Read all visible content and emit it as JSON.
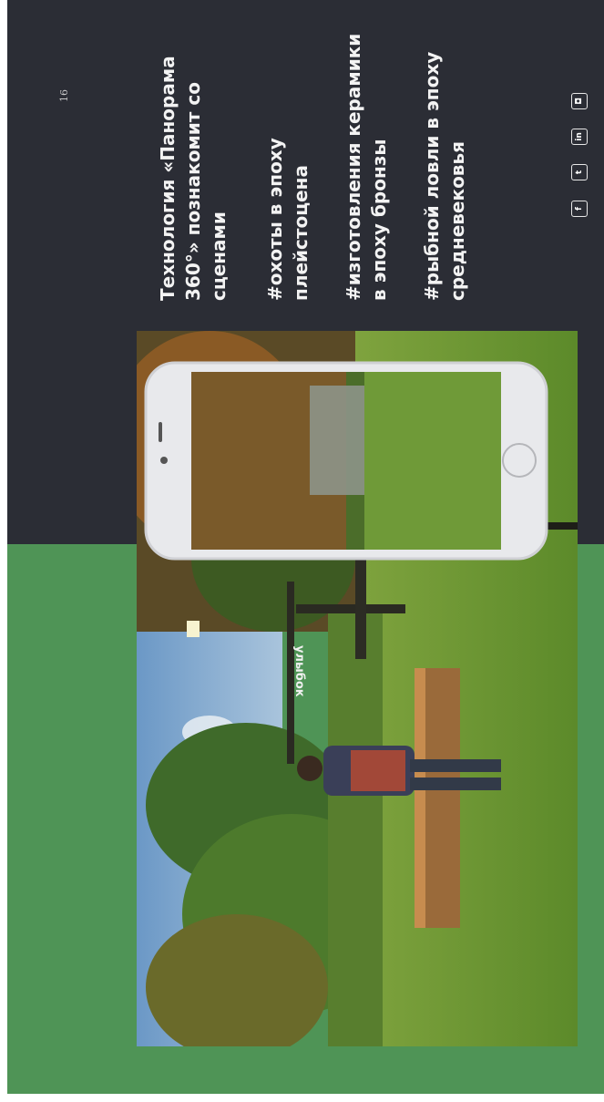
{
  "page": {
    "number": "16",
    "paragraphs": [
      {
        "lines": [
          "Технология «Панорама",
          "360°» познакомит со",
          "сценами"
        ]
      },
      {
        "lines": [
          "#охоты в эпоху",
          "плейстоцена"
        ]
      },
      {
        "lines": [
          "#изготовления керамики",
          "в эпоху бронзы"
        ]
      },
      {
        "lines": [
          "#рыбной ловли в эпоху",
          "средневековья"
        ]
      }
    ]
  },
  "photo": {
    "sign_text": "улыбок"
  },
  "social": [
    {
      "icon": "facebook-icon",
      "glyph": "f"
    },
    {
      "icon": "twitter-icon",
      "glyph": "t"
    },
    {
      "icon": "linkedin-icon",
      "glyph": "in"
    },
    {
      "icon": "instagram-icon",
      "glyph": "◘"
    }
  ],
  "colors": {
    "dark_background": "#2b2d35",
    "green_background": "#4f9456",
    "text": "#f3f3f3"
  }
}
